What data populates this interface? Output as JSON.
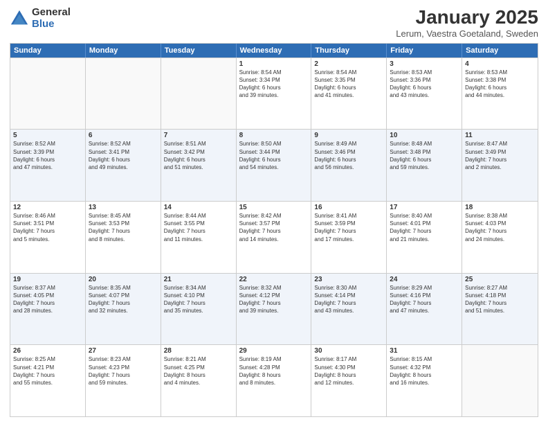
{
  "logo": {
    "general": "General",
    "blue": "Blue"
  },
  "title": {
    "month": "January 2025",
    "location": "Lerum, Vaestra Goetaland, Sweden"
  },
  "days_of_week": [
    "Sunday",
    "Monday",
    "Tuesday",
    "Wednesday",
    "Thursday",
    "Friday",
    "Saturday"
  ],
  "weeks": [
    [
      {
        "num": "",
        "info": ""
      },
      {
        "num": "",
        "info": ""
      },
      {
        "num": "",
        "info": ""
      },
      {
        "num": "1",
        "info": "Sunrise: 8:54 AM\nSunset: 3:34 PM\nDaylight: 6 hours\nand 39 minutes."
      },
      {
        "num": "2",
        "info": "Sunrise: 8:54 AM\nSunset: 3:35 PM\nDaylight: 6 hours\nand 41 minutes."
      },
      {
        "num": "3",
        "info": "Sunrise: 8:53 AM\nSunset: 3:36 PM\nDaylight: 6 hours\nand 43 minutes."
      },
      {
        "num": "4",
        "info": "Sunrise: 8:53 AM\nSunset: 3:38 PM\nDaylight: 6 hours\nand 44 minutes."
      }
    ],
    [
      {
        "num": "5",
        "info": "Sunrise: 8:52 AM\nSunset: 3:39 PM\nDaylight: 6 hours\nand 47 minutes."
      },
      {
        "num": "6",
        "info": "Sunrise: 8:52 AM\nSunset: 3:41 PM\nDaylight: 6 hours\nand 49 minutes."
      },
      {
        "num": "7",
        "info": "Sunrise: 8:51 AM\nSunset: 3:42 PM\nDaylight: 6 hours\nand 51 minutes."
      },
      {
        "num": "8",
        "info": "Sunrise: 8:50 AM\nSunset: 3:44 PM\nDaylight: 6 hours\nand 54 minutes."
      },
      {
        "num": "9",
        "info": "Sunrise: 8:49 AM\nSunset: 3:46 PM\nDaylight: 6 hours\nand 56 minutes."
      },
      {
        "num": "10",
        "info": "Sunrise: 8:48 AM\nSunset: 3:48 PM\nDaylight: 6 hours\nand 59 minutes."
      },
      {
        "num": "11",
        "info": "Sunrise: 8:47 AM\nSunset: 3:49 PM\nDaylight: 7 hours\nand 2 minutes."
      }
    ],
    [
      {
        "num": "12",
        "info": "Sunrise: 8:46 AM\nSunset: 3:51 PM\nDaylight: 7 hours\nand 5 minutes."
      },
      {
        "num": "13",
        "info": "Sunrise: 8:45 AM\nSunset: 3:53 PM\nDaylight: 7 hours\nand 8 minutes."
      },
      {
        "num": "14",
        "info": "Sunrise: 8:44 AM\nSunset: 3:55 PM\nDaylight: 7 hours\nand 11 minutes."
      },
      {
        "num": "15",
        "info": "Sunrise: 8:42 AM\nSunset: 3:57 PM\nDaylight: 7 hours\nand 14 minutes."
      },
      {
        "num": "16",
        "info": "Sunrise: 8:41 AM\nSunset: 3:59 PM\nDaylight: 7 hours\nand 17 minutes."
      },
      {
        "num": "17",
        "info": "Sunrise: 8:40 AM\nSunset: 4:01 PM\nDaylight: 7 hours\nand 21 minutes."
      },
      {
        "num": "18",
        "info": "Sunrise: 8:38 AM\nSunset: 4:03 PM\nDaylight: 7 hours\nand 24 minutes."
      }
    ],
    [
      {
        "num": "19",
        "info": "Sunrise: 8:37 AM\nSunset: 4:05 PM\nDaylight: 7 hours\nand 28 minutes."
      },
      {
        "num": "20",
        "info": "Sunrise: 8:35 AM\nSunset: 4:07 PM\nDaylight: 7 hours\nand 32 minutes."
      },
      {
        "num": "21",
        "info": "Sunrise: 8:34 AM\nSunset: 4:10 PM\nDaylight: 7 hours\nand 35 minutes."
      },
      {
        "num": "22",
        "info": "Sunrise: 8:32 AM\nSunset: 4:12 PM\nDaylight: 7 hours\nand 39 minutes."
      },
      {
        "num": "23",
        "info": "Sunrise: 8:30 AM\nSunset: 4:14 PM\nDaylight: 7 hours\nand 43 minutes."
      },
      {
        "num": "24",
        "info": "Sunrise: 8:29 AM\nSunset: 4:16 PM\nDaylight: 7 hours\nand 47 minutes."
      },
      {
        "num": "25",
        "info": "Sunrise: 8:27 AM\nSunset: 4:18 PM\nDaylight: 7 hours\nand 51 minutes."
      }
    ],
    [
      {
        "num": "26",
        "info": "Sunrise: 8:25 AM\nSunset: 4:21 PM\nDaylight: 7 hours\nand 55 minutes."
      },
      {
        "num": "27",
        "info": "Sunrise: 8:23 AM\nSunset: 4:23 PM\nDaylight: 7 hours\nand 59 minutes."
      },
      {
        "num": "28",
        "info": "Sunrise: 8:21 AM\nSunset: 4:25 PM\nDaylight: 8 hours\nand 4 minutes."
      },
      {
        "num": "29",
        "info": "Sunrise: 8:19 AM\nSunset: 4:28 PM\nDaylight: 8 hours\nand 8 minutes."
      },
      {
        "num": "30",
        "info": "Sunrise: 8:17 AM\nSunset: 4:30 PM\nDaylight: 8 hours\nand 12 minutes."
      },
      {
        "num": "31",
        "info": "Sunrise: 8:15 AM\nSunset: 4:32 PM\nDaylight: 8 hours\nand 16 minutes."
      },
      {
        "num": "",
        "info": ""
      }
    ]
  ]
}
